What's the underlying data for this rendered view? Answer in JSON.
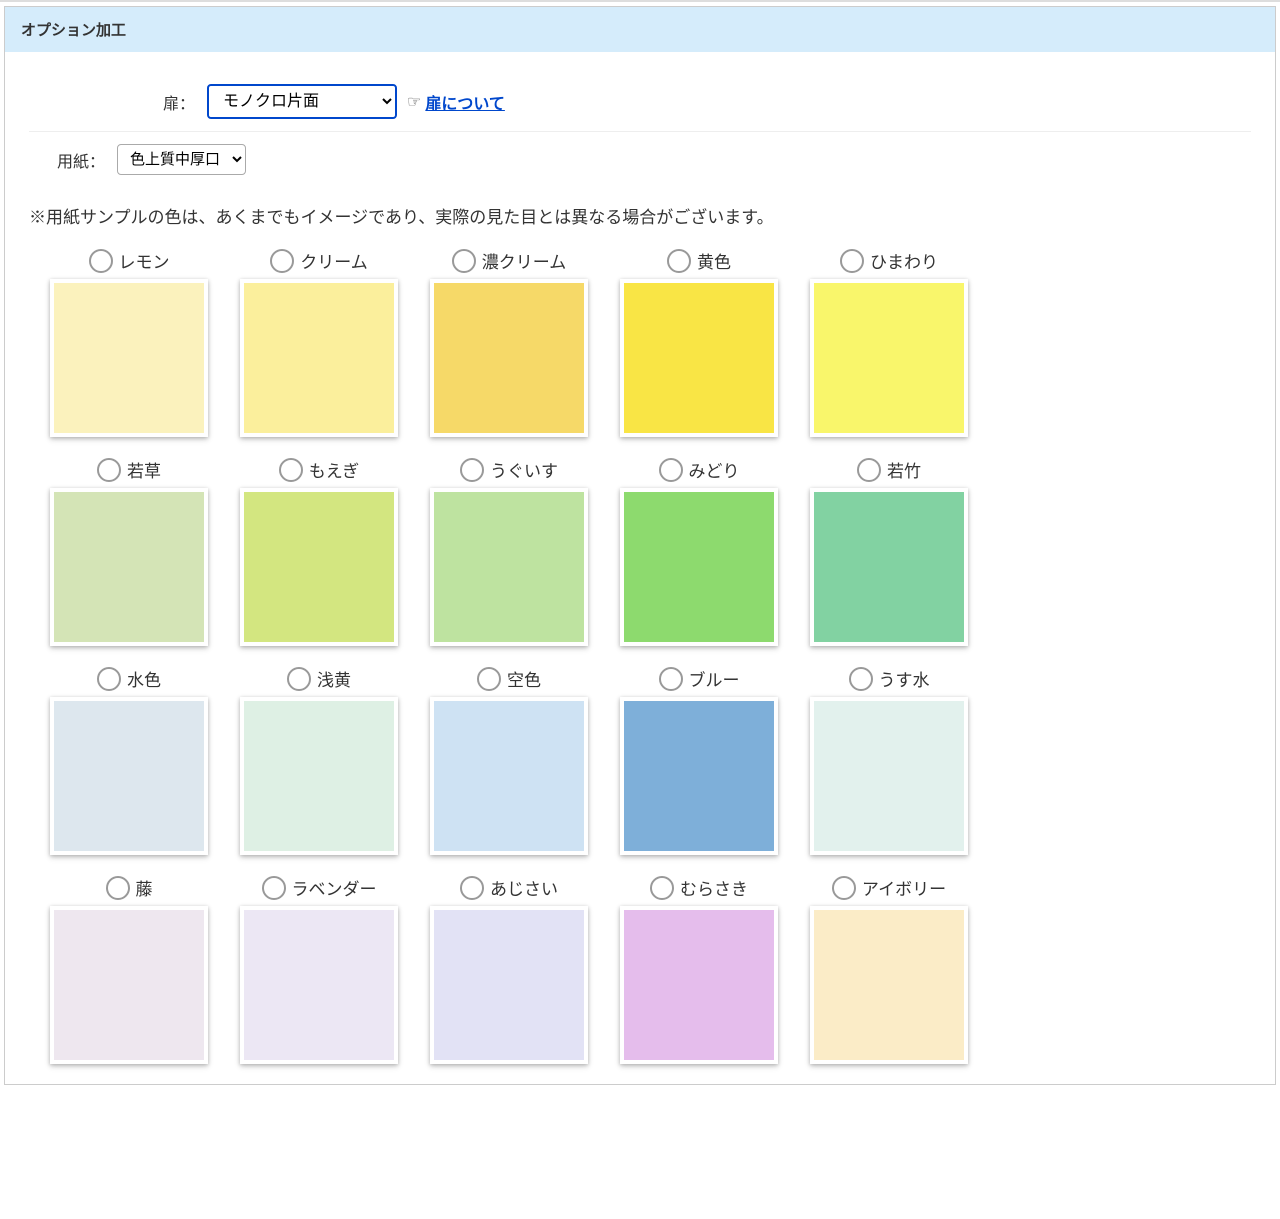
{
  "header": {
    "title": "オプション加工"
  },
  "form": {
    "door_label": "扉：",
    "door_value": "モノクロ片面",
    "door_link": "扉について",
    "paper_label": "用紙：",
    "paper_value": "色上質中厚口"
  },
  "notice": "※用紙サンプルの色は、あくまでもイメージであり、実際の見た目とは異なる場合がございます。",
  "swatches": [
    {
      "name": "レモン",
      "color": "#fbf2bd"
    },
    {
      "name": "クリーム",
      "color": "#fbef9c"
    },
    {
      "name": "濃クリーム",
      "color": "#f6d968"
    },
    {
      "name": "黄色",
      "color": "#f9e545"
    },
    {
      "name": "ひまわり",
      "color": "#f9f66b"
    },
    {
      "name": "若草",
      "color": "#d4e4b6"
    },
    {
      "name": "もえぎ",
      "color": "#d3e680"
    },
    {
      "name": "うぐいす",
      "color": "#bee3a0"
    },
    {
      "name": "みどり",
      "color": "#8dda6e"
    },
    {
      "name": "若竹",
      "color": "#82d2a2"
    },
    {
      "name": "水色",
      "color": "#dde7ee"
    },
    {
      "name": "浅黄",
      "color": "#def0e4"
    },
    {
      "name": "空色",
      "color": "#cee2f3"
    },
    {
      "name": "ブルー",
      "color": "#7eafd9"
    },
    {
      "name": "うす水",
      "color": "#e2f1ed"
    },
    {
      "name": "藤",
      "color": "#eee7ef"
    },
    {
      "name": "ラベンダー",
      "color": "#ece7f4"
    },
    {
      "name": "あじさい",
      "color": "#e2e2f5"
    },
    {
      "name": "むらさき",
      "color": "#e5bdec"
    },
    {
      "name": "アイボリー",
      "color": "#fbecc7"
    }
  ]
}
